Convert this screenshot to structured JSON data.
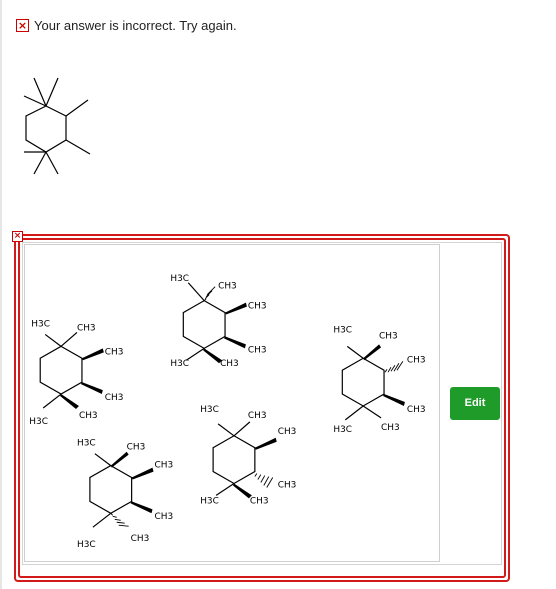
{
  "feedback": {
    "icon": "error-x-icon",
    "text": "Your answer is incorrect.  Try again."
  },
  "marker_icon": "error-x-icon",
  "edit_label": "Edit",
  "molecules": [
    {
      "labels": [
        "H3C",
        "CH3",
        "CH3",
        "CH3",
        "H3C",
        "CH3"
      ]
    },
    {
      "labels": [
        "H3C",
        "CH3",
        "CH3",
        "CH3",
        "H3C",
        "CH3"
      ]
    },
    {
      "labels": [
        "H3C",
        "CH3",
        "CH3",
        "CH3",
        "H3C",
        "CH3"
      ]
    },
    {
      "labels": [
        "H3C",
        "CH3",
        "CH3",
        "CH3",
        "H3C",
        "CH3"
      ]
    },
    {
      "labels": [
        "H3C",
        "CH3",
        "CH3",
        "CH3",
        "H3C",
        "CH3"
      ]
    }
  ]
}
